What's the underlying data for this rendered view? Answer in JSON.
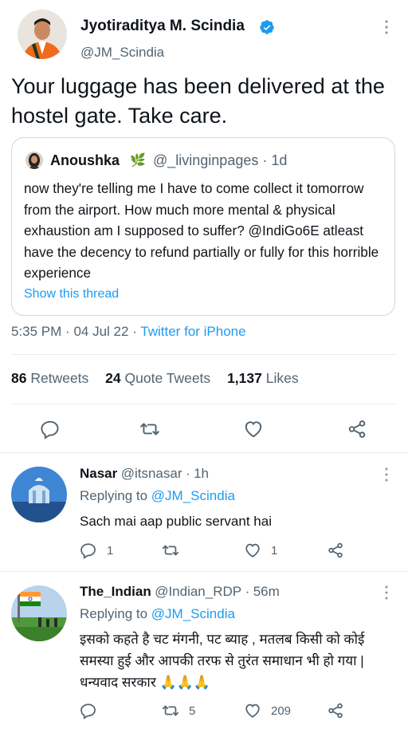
{
  "main_tweet": {
    "author_name": "Jyotiraditya M. Scindia",
    "author_handle": "@JM_Scindia",
    "text": "Your luggage has been delivered at the hostel gate. Take care.",
    "time": "5:35 PM",
    "date": "04 Jul 22",
    "source": "Twitter for iPhone",
    "retweets_count": "86",
    "retweets_label": "Retweets",
    "quotes_count": "24",
    "quotes_label": "Quote Tweets",
    "likes_count": "1,137",
    "likes_label": "Likes"
  },
  "quoted_tweet": {
    "author_name": "Anoushka",
    "author_emoji": "🌿",
    "author_handle": "@_livinginpages",
    "age": "1d",
    "text": "now they're telling me I have to come collect it tomorrow from the airport. How much more mental & physical exhaustion am I supposed to suffer? @IndiGo6E atleast have the decency to refund partially or fully for this horrible experience",
    "show_thread": "Show this thread"
  },
  "replies": [
    {
      "name": "Nasar",
      "handle": "@itsnasar",
      "age": "1h",
      "replying_prefix": "Replying to",
      "replying_to": "@JM_Scindia",
      "text": "Sach mai aap public servant hai",
      "reply_count": "1",
      "retweet_count": "",
      "like_count": "1"
    },
    {
      "name": "The_Indian",
      "handle": "@Indian_RDP",
      "age": "56m",
      "replying_prefix": "Replying to",
      "replying_to": "@JM_Scindia",
      "text": "इसको कहते है चट मंगनी, पट ब्याह , मतलब किसी को कोई समस्या हुई और आपकी तरफ से तुरंत समाधान भी हो गया | धन्यवाद सरकार 🙏🙏🙏",
      "reply_count": "",
      "retweet_count": "5",
      "like_count": "209"
    }
  ],
  "colors": {
    "accent": "#1d9bf0",
    "text": "#0f1419",
    "muted": "#536471",
    "border": "#cfd9de"
  },
  "icons": [
    "verified-badge-icon",
    "more-icon",
    "reply-icon",
    "retweet-icon",
    "like-icon",
    "share-icon"
  ]
}
